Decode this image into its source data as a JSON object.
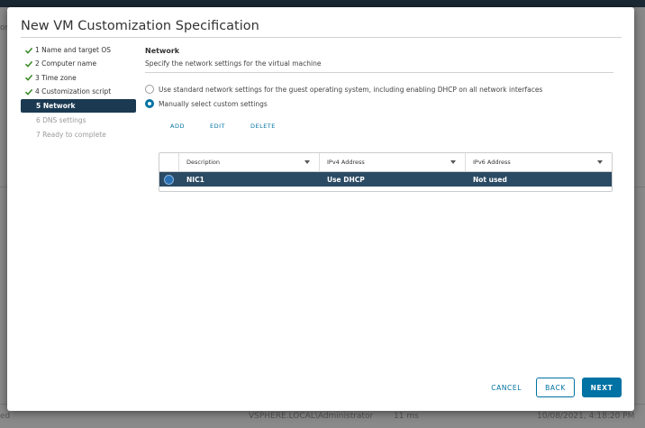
{
  "background": {
    "left_fragment": "on",
    "bottom_left_fragment": "ed",
    "bottom_user": "VSPHERE.LOCAL\\Administrator",
    "bottom_duration": "11 ms",
    "bottom_time": "10/08/2021, 4:18:20 PM"
  },
  "dialog": {
    "title": "New VM Customization Specification"
  },
  "steps": [
    {
      "label": "1 Name and target OS",
      "state": "done"
    },
    {
      "label": "2 Computer name",
      "state": "done"
    },
    {
      "label": "3 Time zone",
      "state": "done"
    },
    {
      "label": "4 Customization script",
      "state": "done"
    },
    {
      "label": "5 Network",
      "state": "current"
    },
    {
      "label": "6 DNS settings",
      "state": "pending"
    },
    {
      "label": "7 Ready to complete",
      "state": "pending"
    }
  ],
  "network": {
    "title": "Network",
    "description": "Specify the network settings for the virtual machine",
    "options": [
      {
        "label": "Use standard network settings for the guest operating system, including enabling DHCP on all network interfaces",
        "selected": false
      },
      {
        "label": "Manually select custom settings",
        "selected": true
      }
    ],
    "actions": {
      "add": "ADD",
      "edit": "EDIT",
      "delete": "DELETE"
    },
    "grid": {
      "columns": [
        "Description",
        "IPv4 Address",
        "IPv6 Address"
      ],
      "rows": [
        {
          "description": "NIC1",
          "ipv4": "Use DHCP",
          "ipv6": "Not used",
          "selected": true
        }
      ]
    }
  },
  "footer": {
    "cancel": "CANCEL",
    "back": "BACK",
    "next": "NEXT"
  },
  "colors": {
    "accent": "#0072a3",
    "selected_row": "#2b4a63",
    "current_step": "#1b3a52",
    "check": "#3a8a27"
  }
}
